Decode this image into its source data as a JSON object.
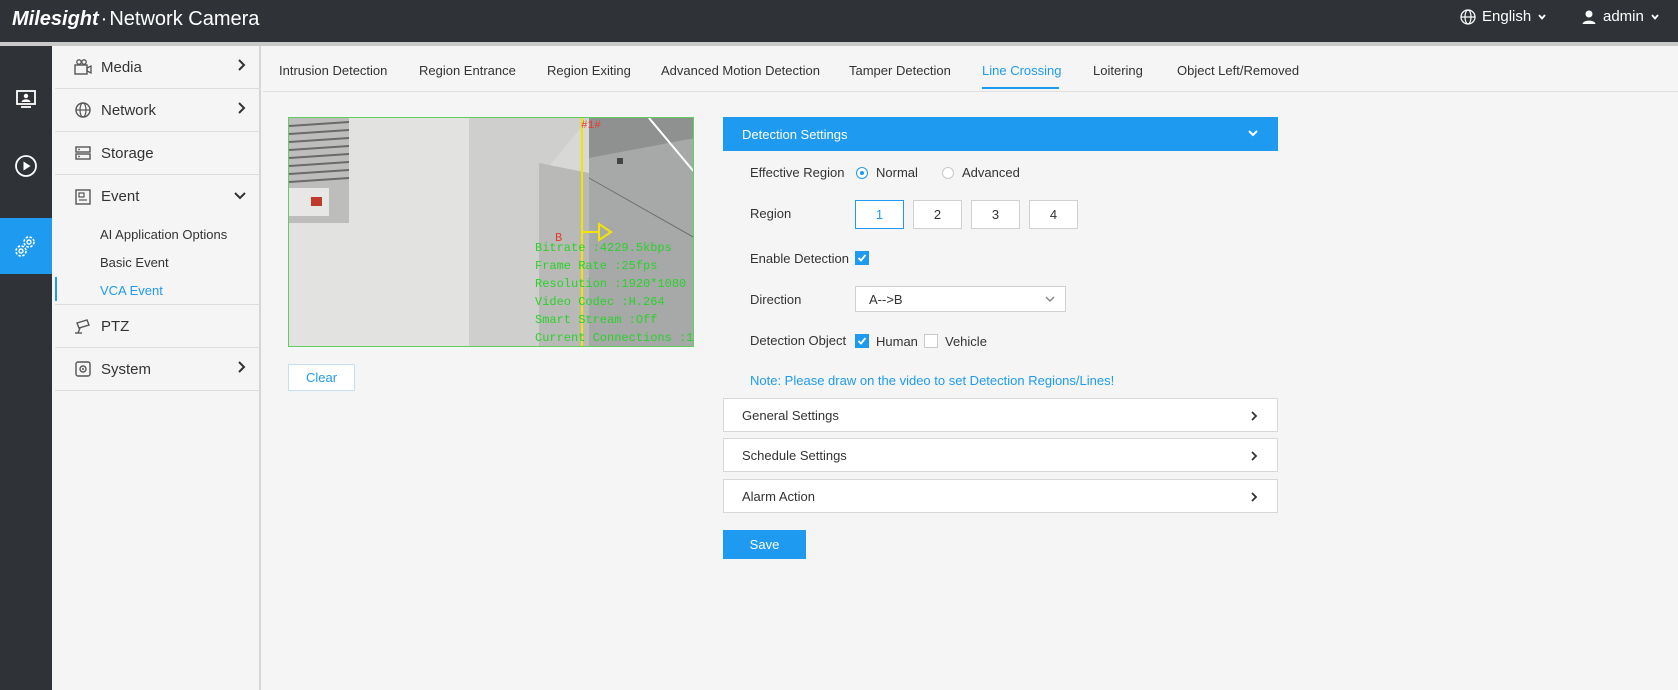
{
  "header": {
    "brand_logo": "Milesight",
    "brand_sep": "·",
    "brand_product": "Network Camera",
    "language": "English",
    "user": "admin",
    "icons": [
      "globe-icon",
      "user-icon",
      "chevron-down-icon"
    ]
  },
  "iconbar": {
    "items": [
      {
        "name": "live-view-icon"
      },
      {
        "name": "playback-icon"
      },
      {
        "name": "settings-icon",
        "active": true
      }
    ]
  },
  "sidebar": {
    "items": [
      {
        "label": "Media",
        "icon": "media-icon"
      },
      {
        "label": "Network",
        "icon": "network-icon"
      },
      {
        "label": "Storage",
        "icon": "storage-icon"
      },
      {
        "label": "Event",
        "icon": "event-icon",
        "expanded": true
      },
      {
        "label": "PTZ",
        "icon": "ptz-icon"
      },
      {
        "label": "System",
        "icon": "system-icon"
      }
    ],
    "sub_items": [
      "AI Application Options",
      "Basic Event",
      "VCA Event"
    ],
    "active_sub": "VCA Event"
  },
  "tabs": [
    "Intrusion Detection",
    "Region Entrance",
    "Region Exiting",
    "Advanced Motion Detection",
    "Tamper Detection",
    "Line Crossing",
    "Loitering",
    "Object Left/Removed"
  ],
  "active_tab": "Line Crossing",
  "video": {
    "line_label": "#1#",
    "side_label": "B",
    "osd": [
      "Bitrate :4229.5kbps",
      "Frame Rate :25fps",
      "Resolution :1920*1080",
      "Video Codec :H.264",
      "Smart Stream :Off",
      "Current Connections :1"
    ]
  },
  "clear_label": "Clear",
  "detection": {
    "title": "Detection Settings",
    "effective_region_label": "Effective Region",
    "region_normal": "Normal",
    "region_advanced": "Advanced",
    "region_label": "Region",
    "regions": [
      "1",
      "2",
      "3",
      "4"
    ],
    "active_region": "1",
    "enable_label": "Enable Detection",
    "enable_checked": true,
    "direction_label": "Direction",
    "direction_value": "A-->B",
    "object_label": "Detection Object",
    "obj_human": "Human",
    "obj_human_checked": true,
    "obj_vehicle": "Vehicle",
    "obj_vehicle_checked": false,
    "note": "Note: Please draw on the video to set Detection Regions/Lines!"
  },
  "sections": [
    "General Settings",
    "Schedule Settings",
    "Alarm Action"
  ],
  "save_label": "Save",
  "colors": {
    "accent": "#1e9bf0",
    "topbar": "#2f3338",
    "osd": "#2ad12a",
    "line": "#f2e600"
  }
}
